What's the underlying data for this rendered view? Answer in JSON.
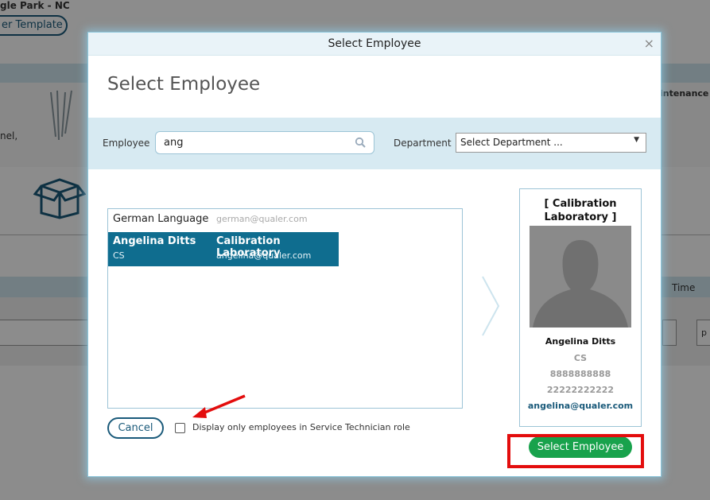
{
  "background": {
    "top_text": "gle Park - NC",
    "template_button": "er Template",
    "side_text": "nel,",
    "column_maintenance": "intenance",
    "column_time": "Time",
    "right_field": "p"
  },
  "modal": {
    "title": "Select Employee",
    "heading": "Select Employee",
    "close": "×",
    "filters": {
      "employee_label": "Employee",
      "employee_value": "ang",
      "department_label": "Department",
      "department_value": "Select Department ..."
    },
    "employees": [
      {
        "name": "German Language",
        "email": "german@qualer.com"
      },
      {
        "name": "Angelina Ditts",
        "role": "CS",
        "department": "Calibration Laboratory",
        "email": "angelina@qualer.com"
      }
    ],
    "card": {
      "department": "[ Calibration Laboratory ]",
      "name": "Angelina Ditts",
      "role": "CS",
      "phone1": "8888888888",
      "phone2": "22222222222",
      "email": "angelina@qualer.com"
    },
    "cancel_label": "Cancel",
    "checkbox_label": "Display only employees in Service Technician role",
    "checkbox_checked": false,
    "select_label": "Select Employee"
  },
  "colors": {
    "accent": "#0f6d8f",
    "primary_button": "#18a24c",
    "highlight": "#e30d0d"
  }
}
